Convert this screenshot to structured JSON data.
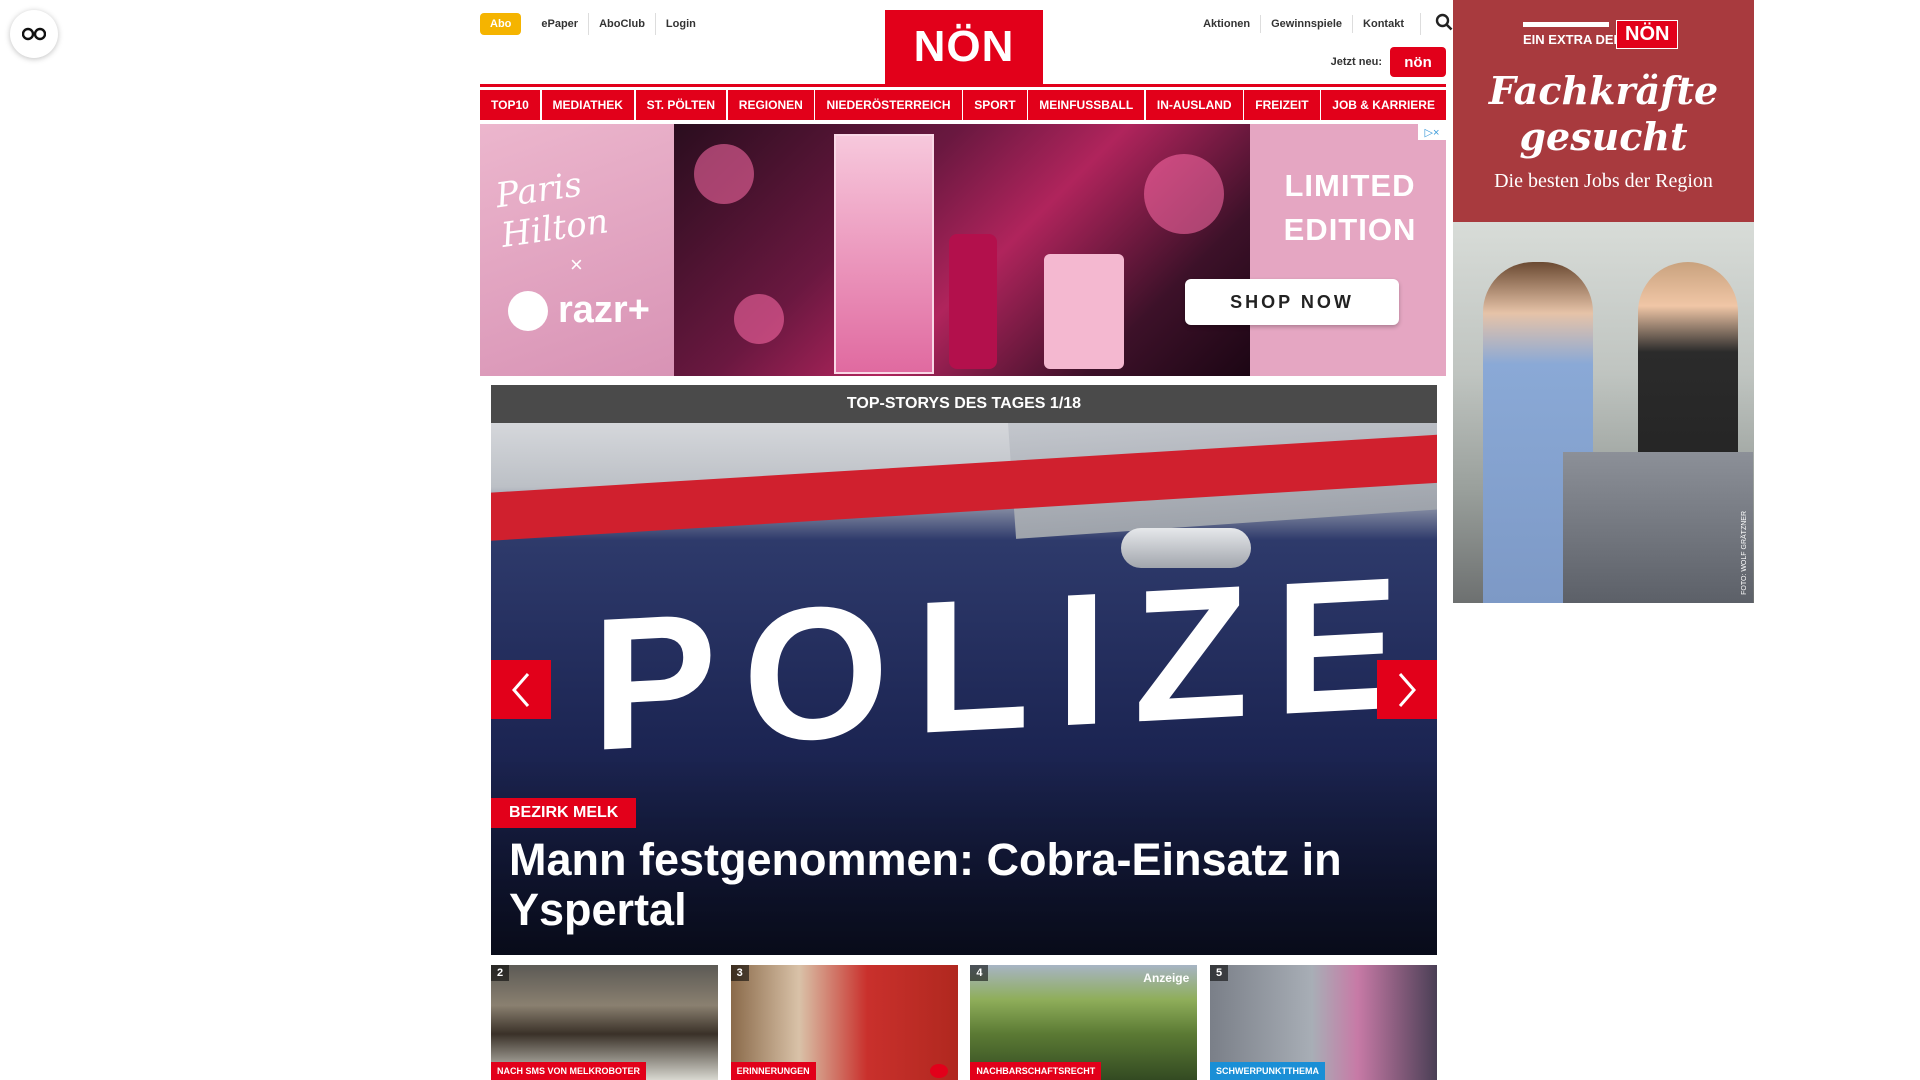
{
  "header": {
    "abo_label": "Abo",
    "top_links": [
      "ePaper",
      "AboClub",
      "Login"
    ],
    "logo_text": "NÖN",
    "right_links": [
      "Aktionen",
      "Gewinnspiele",
      "Kontakt"
    ],
    "jetzt_neu_label": "Jetzt neu:",
    "badge_text": "nön"
  },
  "categories": [
    "TOP10",
    "MEDIATHEK",
    "ST. PÖLTEN",
    "REGIONEN",
    "NIEDERÖSTERREICH",
    "SPORT",
    "MEINFUSSBALL",
    "IN-AUSLAND",
    "FREIZEIT",
    "JOB & KARRIERE"
  ],
  "ad_banner": {
    "brand_script": "Paris Hilton",
    "cross": "×",
    "razr": "razr+",
    "limited_edition": "LIMITED EDITION",
    "shop_now": "SHOP NOW",
    "adchoices": "▷×"
  },
  "top_stories": {
    "heading": "TOP-STORYS DES TAGES 1/18",
    "hero": {
      "image_text": "POLIZEI",
      "tag": "BEZIRK MELK",
      "title": "Mann festgenommen: Cobra-Einsatz in Ysper­tal"
    },
    "thumbnails": [
      {
        "num": "2",
        "tag": "NACH SMS VON MELKROBOTER",
        "tag_color": "#e2001a"
      },
      {
        "num": "3",
        "tag": "ERINNERUNGEN",
        "tag_color": "#e2001a"
      },
      {
        "num": "4",
        "tag": "NACHBARSCHAFTSRECHT",
        "tag_color": "#e2001a",
        "anzeige": "Anzeige"
      },
      {
        "num": "5",
        "tag": "SCHWERPUNKTTHEMA",
        "tag_color": "#1a8fd6"
      }
    ]
  },
  "side_ad": {
    "extra_label": "EIN EXTRA DER",
    "brand": "NÖN",
    "headline": "Fachkräfte gesucht",
    "subline": "Die besten Jobs der Region",
    "credit": "FOTO: WOLF GRÄTZNER"
  },
  "colors": {
    "accent": "#e2001a",
    "abo": "#f5b400",
    "story_header": "#4a4a4a",
    "side_ad_bg": "#a83a3e"
  },
  "icons": [
    "reader-glasses-icon",
    "search-icon",
    "chevron-left-icon",
    "chevron-right-icon",
    "camera-icon"
  ]
}
